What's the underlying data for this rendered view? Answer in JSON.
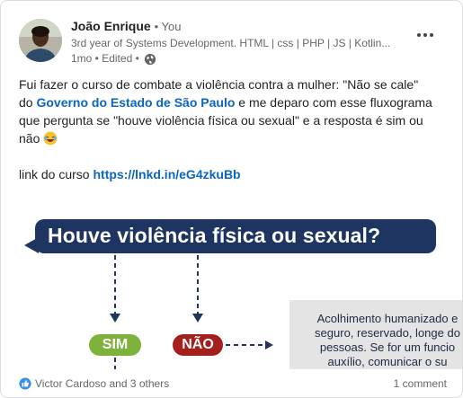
{
  "post": {
    "author": {
      "name": "João Enrique",
      "connection": "• You",
      "headline": "3rd year of Systems Development. HTML | css | PHP | JS | Kotlin...",
      "time": "1mo • Edited •",
      "avatar_icon": "profile-photo"
    },
    "text": {
      "line1_a": "Fui fazer o curso de combate a violência contra a mulher: \"Não se cale\"",
      "line2_pre": "do ",
      "gov_link": "Governo do Estado de São Paulo",
      "line2_post": " e me deparo com esse fluxograma",
      "line3": "que pergunta se \"houve violência física ou sexual\" e a resposta é sim ou",
      "line4": "não ",
      "course_label": "link do curso ",
      "course_link": "https://lnkd.in/eG4zkuBb"
    },
    "image": {
      "question": "Houve violência física ou sexual?",
      "yes": "SIM",
      "no": "NÃO",
      "info_lines": [
        "Acolhimento humanizado e",
        "seguro, reservado, longe do",
        "pessoas. Se for um funcio",
        "auxílio, comunicar o su"
      ],
      "colors": {
        "banner": "#1e3461",
        "yes": "#7fb23d",
        "no": "#a3201d"
      }
    },
    "footer": {
      "reactions": "Victor Cardoso and 3 others",
      "comments": "1 comment"
    }
  }
}
